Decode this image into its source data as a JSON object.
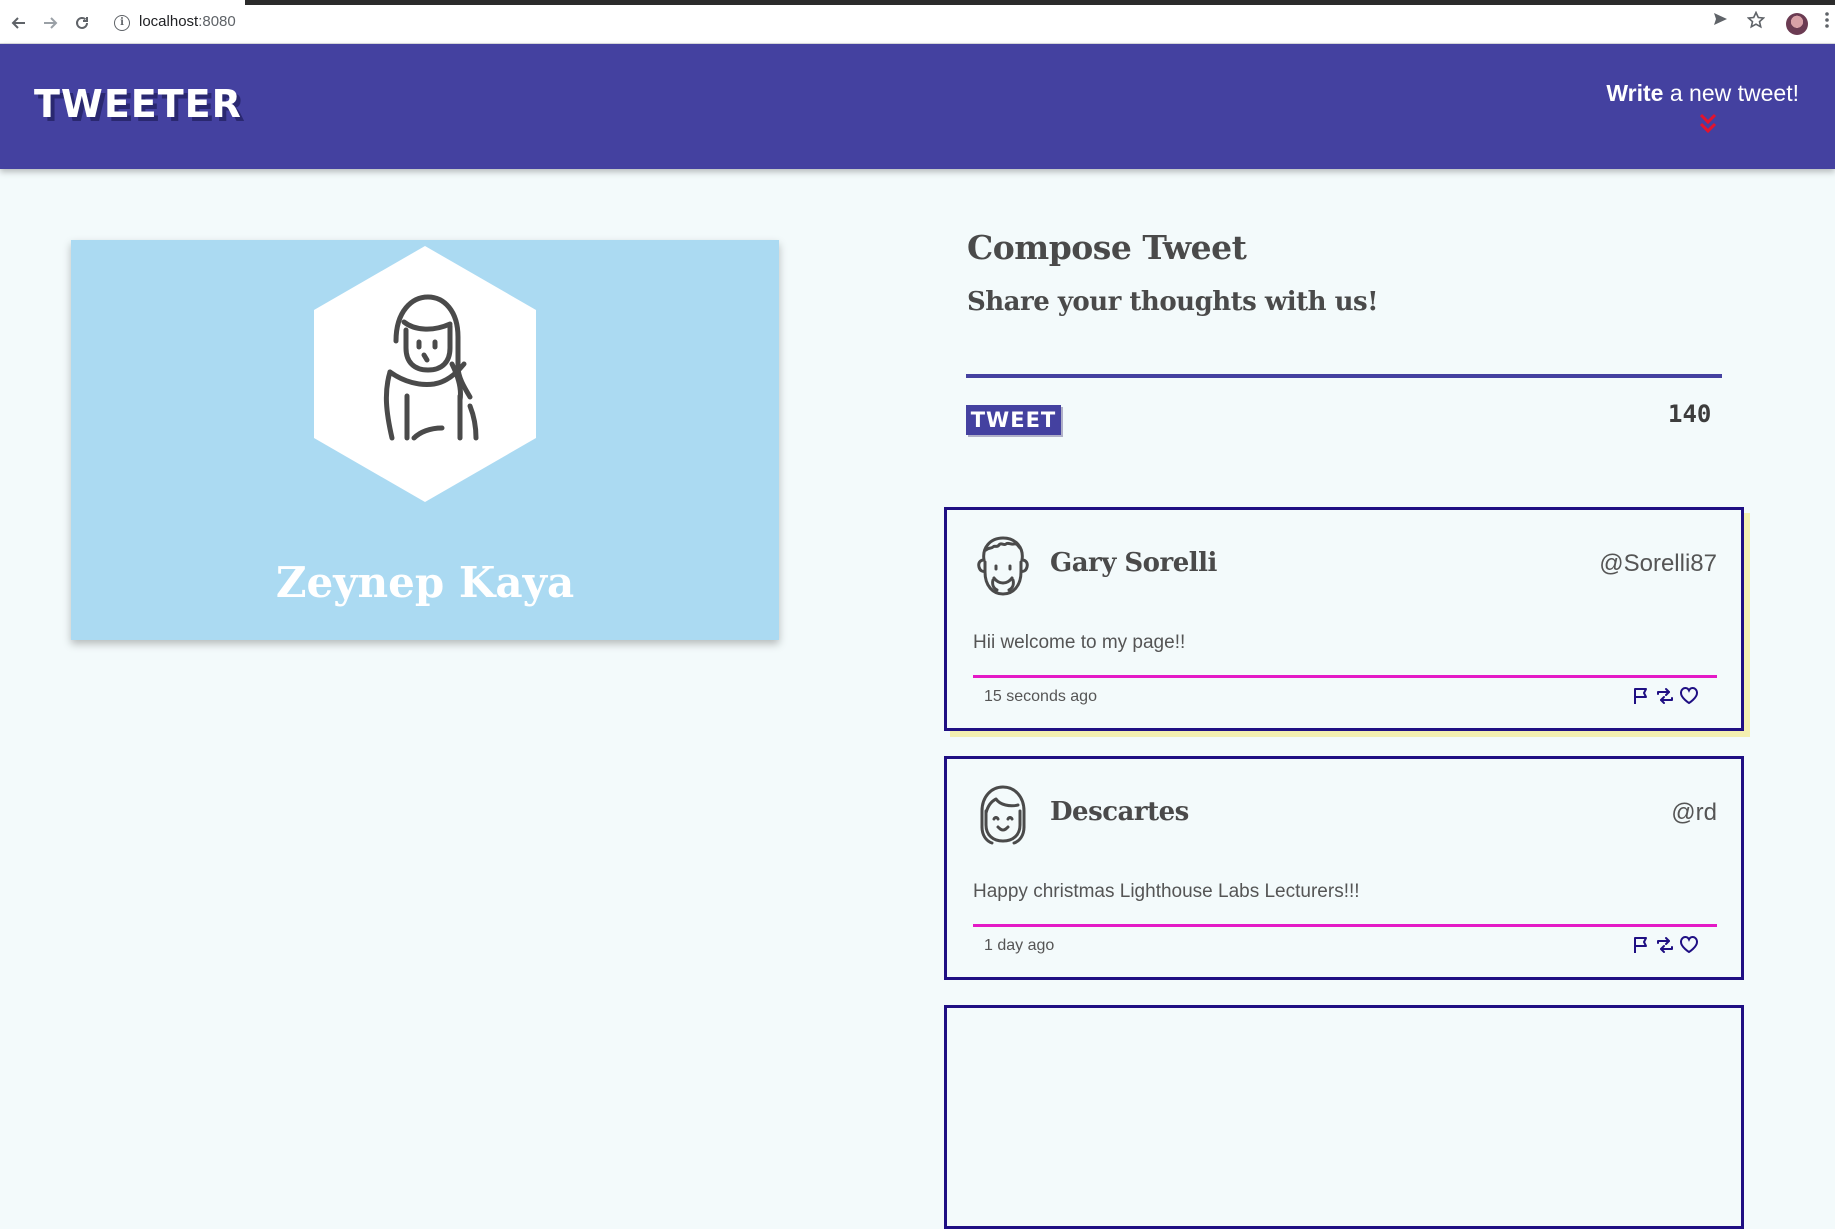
{
  "browser": {
    "url_host": "localhost",
    "url_port": ":8080"
  },
  "header": {
    "brand": "TWEETER",
    "write_bold": "Write",
    "write_rest": " a new tweet!"
  },
  "profile": {
    "name": "Zeynep Kaya"
  },
  "compose": {
    "title": "Compose Tweet",
    "subtitle": "Share your thoughts with us!",
    "input_value": "",
    "button_label": "TWEET",
    "counter": "140"
  },
  "tweets": [
    {
      "name": "Gary Sorelli",
      "handle": "@Sorelli87",
      "body": "Hii welcome to my page!!",
      "time": "15 seconds ago"
    },
    {
      "name": "Descartes",
      "handle": "@rd",
      "body": "Happy christmas Lighthouse Labs Lecturers!!!",
      "time": "1 day ago"
    }
  ],
  "colors": {
    "header_bg": "#4441a0",
    "card_bg": "#abdaf2",
    "tweet_border": "#1f0f83",
    "divider": "#e419c6"
  }
}
